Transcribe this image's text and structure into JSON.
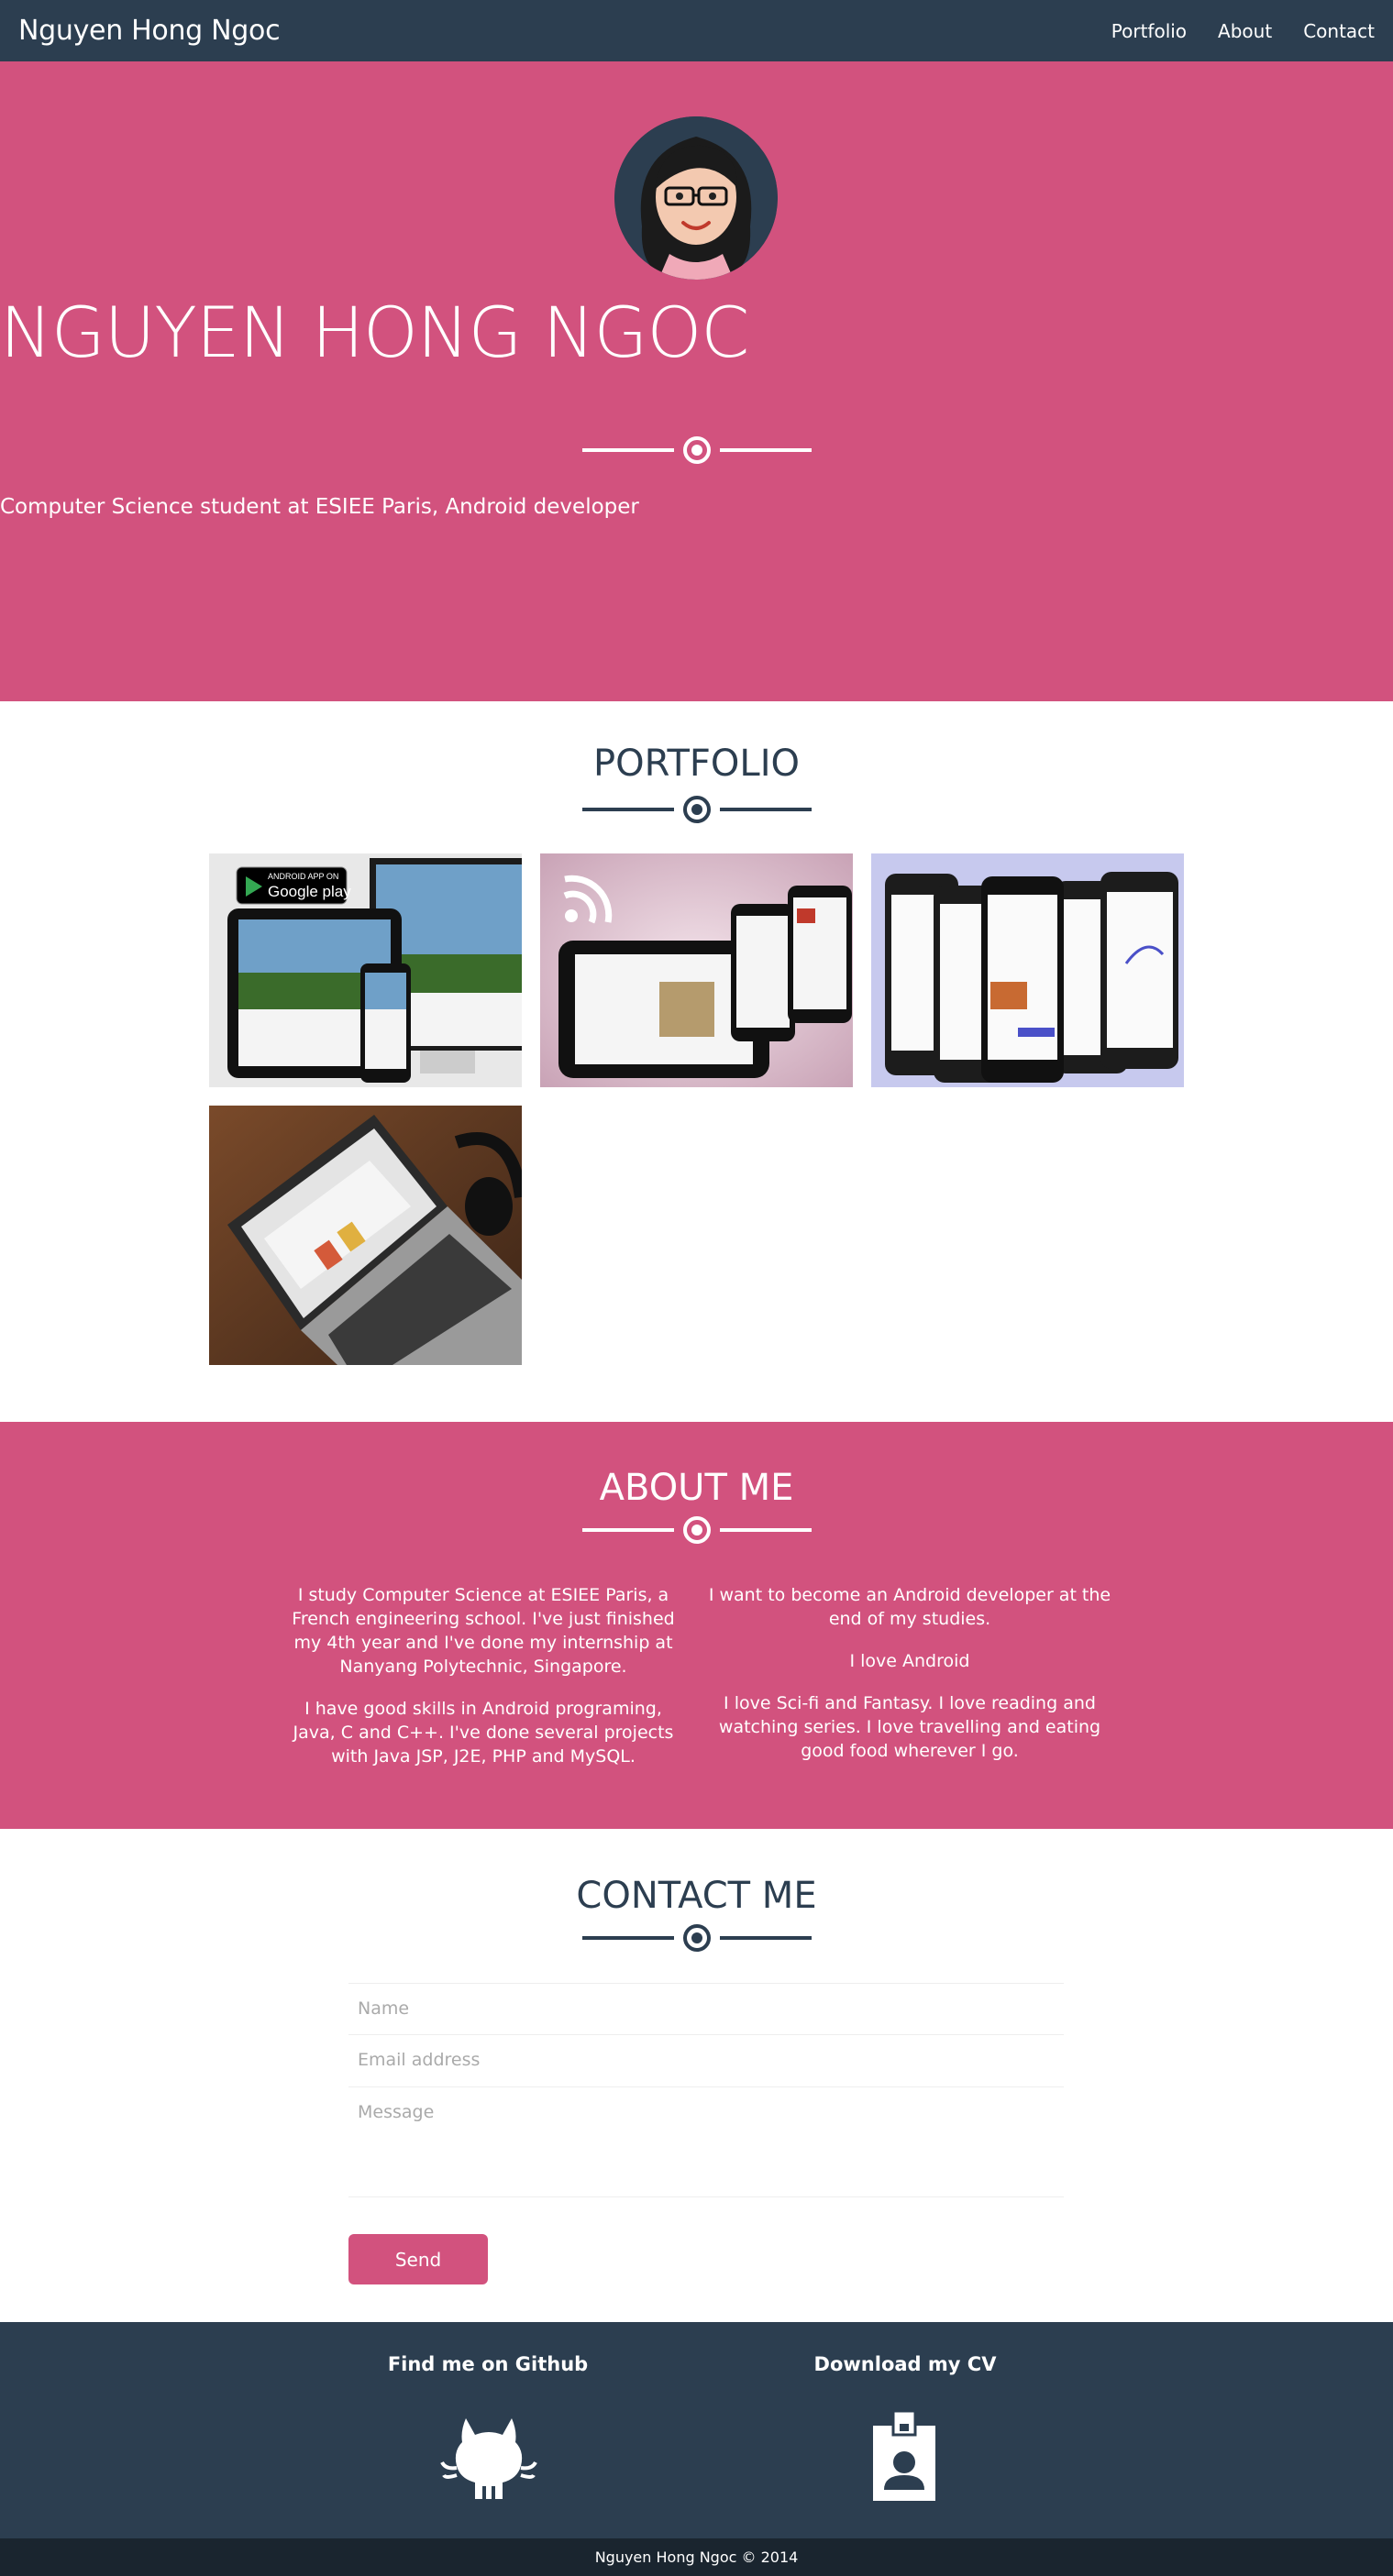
{
  "nav": {
    "brand": "Nguyen Hong Ngoc",
    "links": [
      "Portfolio",
      "About",
      "Contact"
    ]
  },
  "hero": {
    "title": "NGUYEN HONG NGOC",
    "subtitle": "Computer Science student at ESIEE Paris, Android developer"
  },
  "portfolio": {
    "title": "PORTFOLIO",
    "items": [
      {
        "name": "slatch",
        "badge_line1": "ANDROID APP ON",
        "badge_line2": "Google play"
      },
      {
        "name": "rss-reader"
      },
      {
        "name": "chat-app"
      },
      {
        "name": "laptop-web"
      }
    ]
  },
  "about": {
    "title": "ABOUT ME",
    "left": [
      "I study Computer Science at ESIEE Paris, a French engineering school. I've just finished my 4th year and I've done my internship at Nanyang Polytechnic, Singapore.",
      "I have good skills in Android programing, Java, C and C++. I've done several projects with Java JSP, J2E, PHP and MySQL."
    ],
    "right": [
      "I want to become an Android developer at the end of my studies.",
      "I love Android",
      "I love Sci-fi and Fantasy. I love reading and watching series. I love travelling and eating good food wherever I go."
    ]
  },
  "contact": {
    "title": "CONTACT ME",
    "name_placeholder": "Name",
    "email_placeholder": "Email address",
    "message_placeholder": "Message",
    "send_label": "Send"
  },
  "footer": {
    "github_label": "Find me on Github",
    "cv_label": "Download my CV",
    "github_icon": "github-octocat-icon",
    "cv_icon": "id-badge-icon",
    "copyright": "Nguyen Hong Ngoc © 2014"
  },
  "colors": {
    "primary": "#2c3e50",
    "accent": "#d2527e",
    "footer_bottom": "#1a252f"
  }
}
